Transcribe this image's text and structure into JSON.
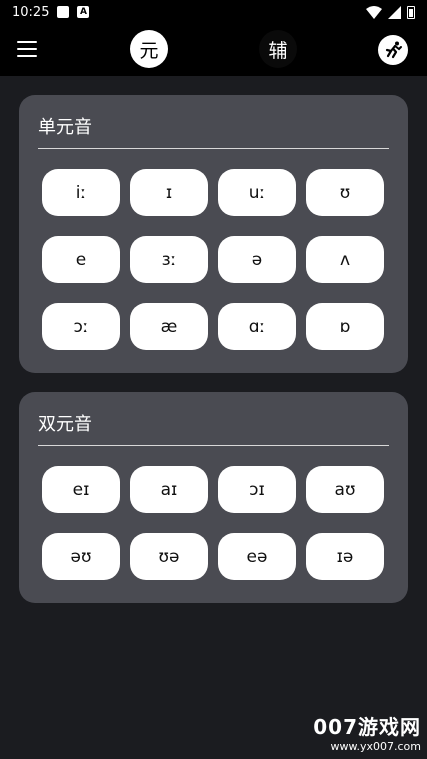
{
  "status_bar": {
    "time": "10:25",
    "notif_letter": "A"
  },
  "app_bar": {
    "tab_vowels": "元",
    "tab_consonants": "辅"
  },
  "monophthongs": {
    "title": "单元音",
    "keys": [
      "iː",
      "ɪ",
      "uː",
      "ʊ",
      "e",
      "ɜː",
      "ə",
      "ʌ",
      "ɔː",
      "æ",
      "ɑː",
      "ɒ"
    ]
  },
  "diphthongs": {
    "title": "双元音",
    "keys": [
      "eɪ",
      "aɪ",
      "ɔɪ",
      "aʊ",
      "əʊ",
      "ʊə",
      "eə",
      "ɪə"
    ]
  },
  "watermark": {
    "title": "007游戏网",
    "url": "www.yx007.com"
  },
  "colors": {
    "background": "#1b1c20",
    "card": "#4a4b52",
    "key": "#ffffff",
    "bar": "#000000"
  }
}
